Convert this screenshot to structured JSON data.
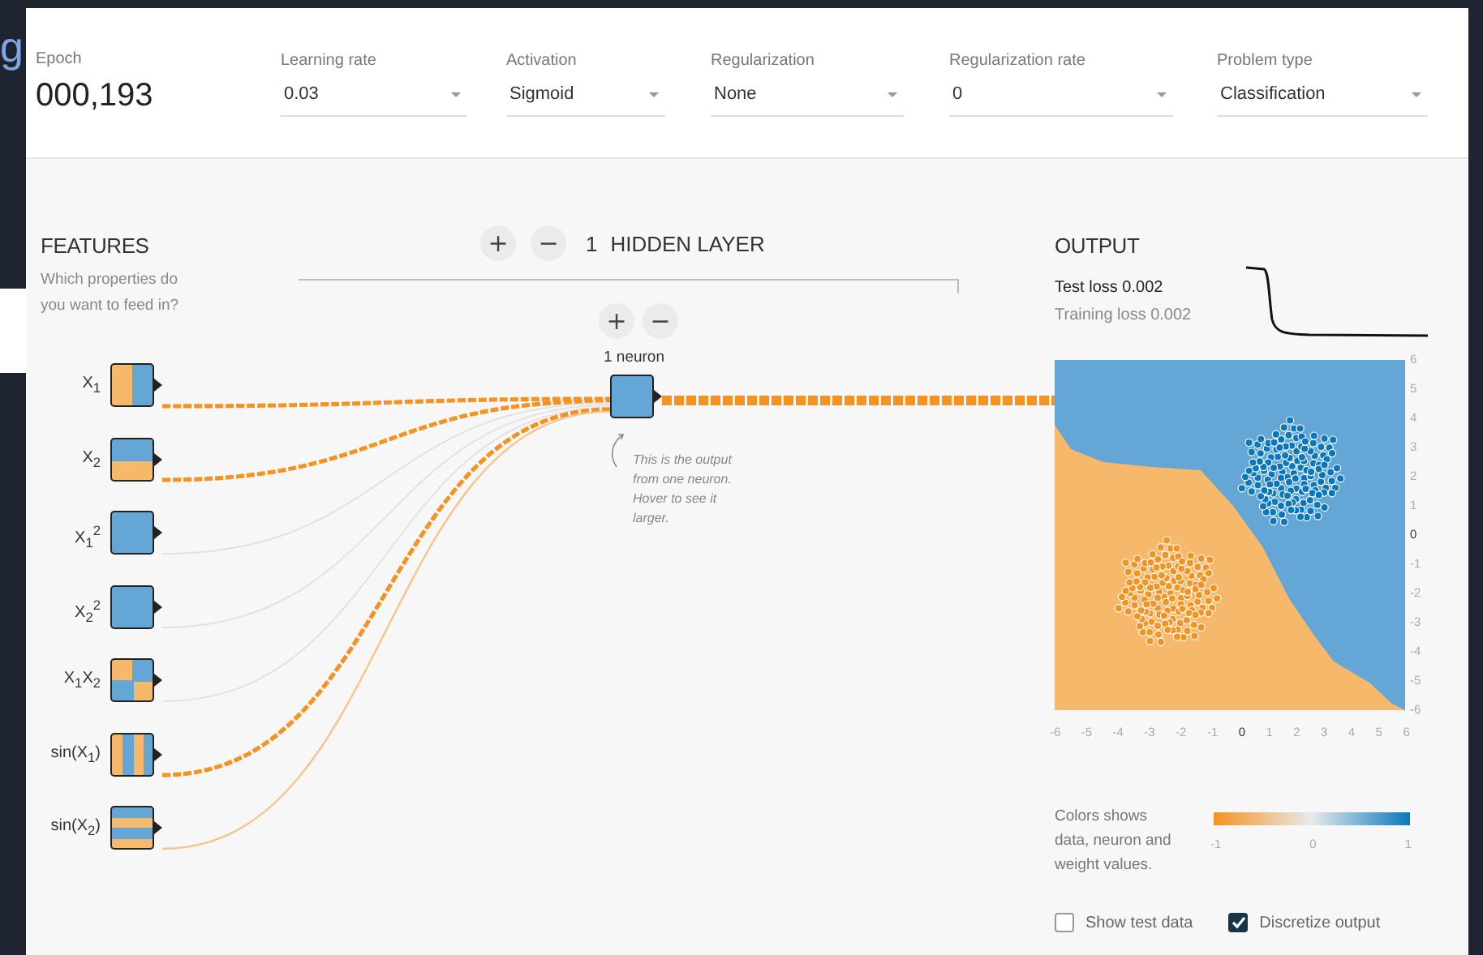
{
  "background_window": {
    "text": "g"
  },
  "header": {
    "epoch": {
      "label": "Epoch",
      "value": "000,193"
    },
    "dropdowns": [
      {
        "label": "Learning rate",
        "value": "0.03"
      },
      {
        "label": "Activation",
        "value": "Sigmoid"
      },
      {
        "label": "Regularization",
        "value": "None"
      },
      {
        "label": "Regularization rate",
        "value": "0"
      },
      {
        "label": "Problem type",
        "value": "Classification"
      }
    ]
  },
  "features": {
    "title": "FEATURES",
    "subtitle": "Which properties do you want to feed in?",
    "items": [
      {
        "label": "X$_{1}$",
        "kind": "vsplit"
      },
      {
        "label": "X$_{2}$",
        "kind": "hsplit"
      },
      {
        "label": "X$_{1}$$^{2}$",
        "kind": "solid"
      },
      {
        "label": "X$_{2}$$^{2}$",
        "kind": "solid"
      },
      {
        "label": "X$_{1}$X$_{2}$",
        "kind": "checker"
      },
      {
        "label": "sin(X$_{1}$)",
        "kind": "vstripes"
      },
      {
        "label": "sin(X$_{2}$)",
        "kind": "hstripes"
      }
    ],
    "connections": [
      {
        "kind": "strong"
      },
      {
        "kind": "strong"
      },
      {
        "kind": "faint"
      },
      {
        "kind": "faint"
      },
      {
        "kind": "faint"
      },
      {
        "kind": "strong"
      },
      {
        "kind": "light"
      }
    ]
  },
  "hidden_layers": {
    "add": "+",
    "remove": "−",
    "count": "1",
    "title": "HIDDEN LAYER",
    "layer": {
      "add": "+",
      "remove": "−",
      "neurons": "1 neuron",
      "output_connection": {
        "kind": "strong"
      },
      "note": "This is the output from one neuron. Hover to see it larger."
    }
  },
  "output": {
    "title": "OUTPUT",
    "test_loss": "Test loss 0.002",
    "training_loss": "Training loss 0.002",
    "y_ticks": [
      "6",
      "5",
      "4",
      "3",
      "2",
      "1",
      "0",
      "-1",
      "-2",
      "-3",
      "-4",
      "-5",
      "-6"
    ],
    "x_ticks": [
      "-6",
      "-5",
      "-4",
      "-3",
      "-2",
      "-1",
      "0",
      "1",
      "2",
      "3",
      "4",
      "5",
      "6"
    ],
    "colorbar": {
      "caption": "Colors shows data, neuron and weight values.",
      "ticks": [
        "-1",
        "0",
        "1"
      ]
    },
    "checkboxes": [
      {
        "label": "Show test data",
        "checked": false
      },
      {
        "label": "Discretize output",
        "checked": true
      }
    ]
  }
}
